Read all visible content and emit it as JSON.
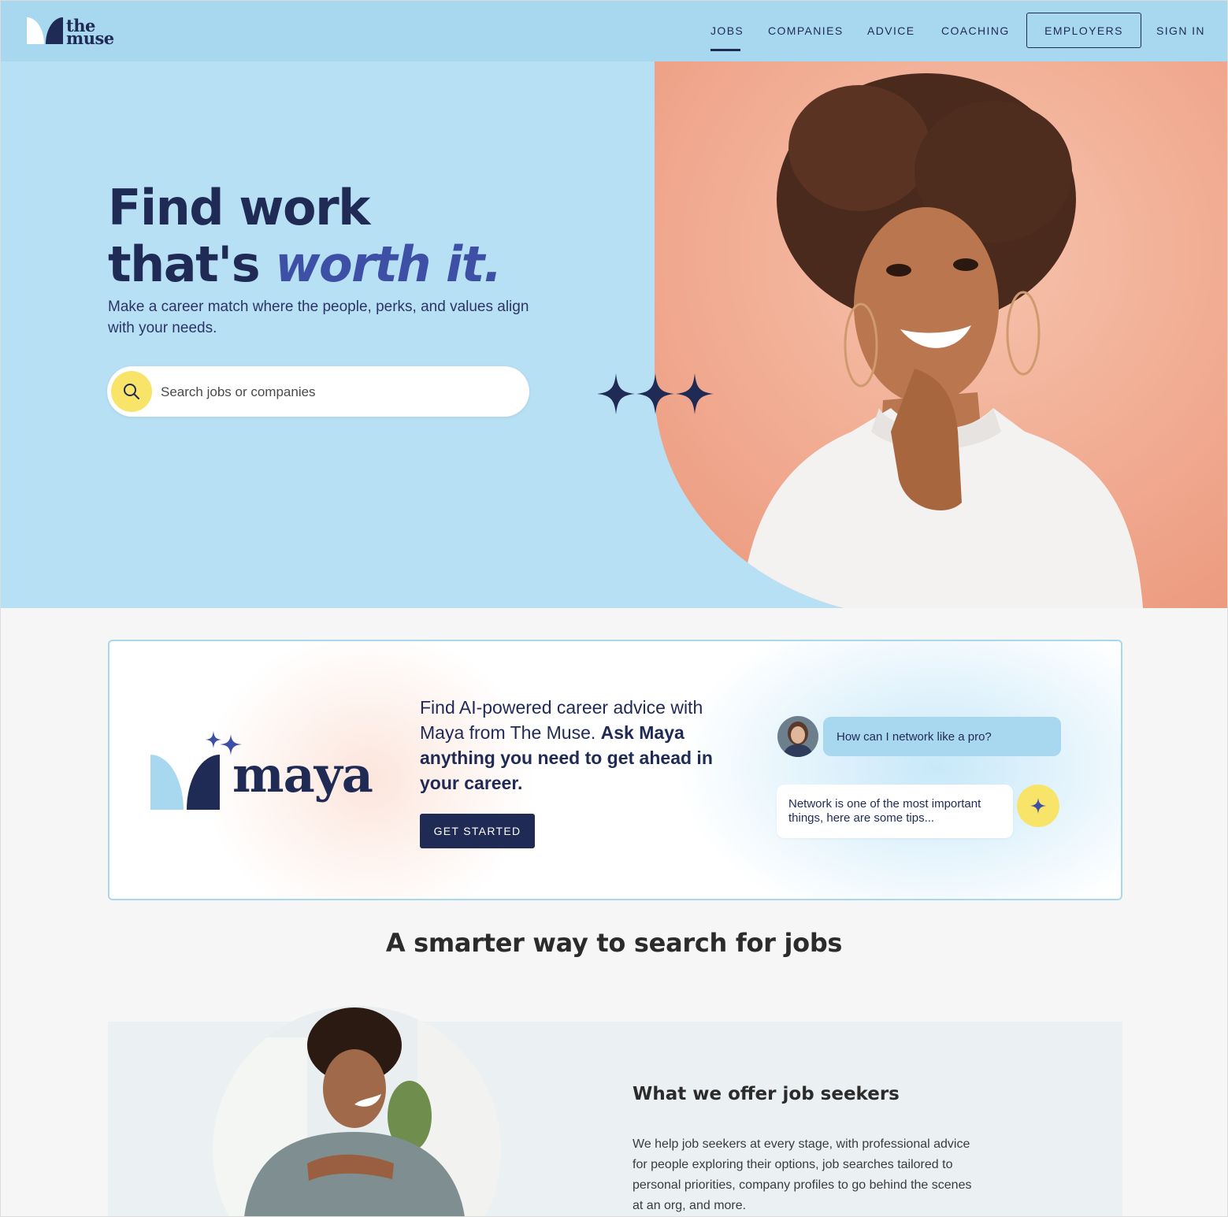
{
  "nav": {
    "logo_line1": "the",
    "logo_line2": "muse",
    "items": [
      "JOBS",
      "COMPANIES",
      "ADVICE",
      "COACHING"
    ],
    "active": "JOBS",
    "employers": "EMPLOYERS",
    "sign_in": "SIGN IN"
  },
  "hero": {
    "title_line1": "Find work",
    "title_line2_plain": "that's ",
    "title_line2_accent": "worth it.",
    "subtitle": "Make a career match where the people, perks, and values align with your needs.",
    "search_placeholder": "Search jobs or companies"
  },
  "maya": {
    "logo_word": "maya",
    "text_plain": "Find AI-powered career advice with Maya from The Muse. ",
    "text_bold": "Ask Maya anything you need to get ahead in your career.",
    "button": "GET STARTED",
    "chat_question": "How can I network like a pro?",
    "chat_answer": "Network is one of the most important things, here are some tips..."
  },
  "section_title": "A smarter way to search for jobs",
  "offer": {
    "title": "What we offer job seekers",
    "body": "We help job seekers at every stage, with professional advice for people exploring their options, job searches tailored to personal priorities, company profiles to go behind the scenes at an org, and more."
  },
  "colors": {
    "navy": "#1f2a55",
    "accent_blue": "#3e4fa6",
    "sky": "#b8e0f4",
    "nav_blue": "#a8d8f0",
    "salmon": "#f0a48a",
    "yellow": "#f8e468"
  },
  "icons": {
    "search": "search-icon",
    "sparkle": "sparkle-icon"
  }
}
